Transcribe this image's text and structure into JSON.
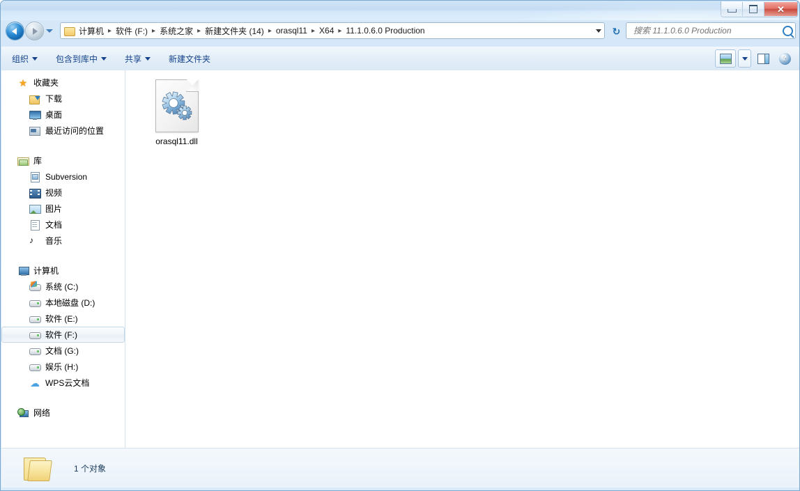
{
  "window": {
    "controls": {
      "minimize_label": "—",
      "maximize_label": "❐",
      "close_label": "✕"
    }
  },
  "navigation": {
    "back_label": "后退",
    "forward_label": "前进",
    "recent_dropdown_label": "最近浏览的位置",
    "refresh_label": "刷新",
    "refresh_glyph": "↻"
  },
  "address": {
    "folder_icon": "folder-icon",
    "breadcrumbs": [
      "计算机",
      "软件 (F:)",
      "系统之家",
      "新建文件夹 (14)",
      "orasql11",
      "X64",
      "11.1.0.6.0 Production"
    ],
    "separator": "▸",
    "dropdown_label": "▾"
  },
  "search": {
    "placeholder": "搜索 11.1.0.6.0 Production",
    "value": "",
    "icon": "search-icon"
  },
  "toolbar": {
    "items": [
      {
        "label": "组织",
        "has_caret": true
      },
      {
        "label": "包含到库中",
        "has_caret": true
      },
      {
        "label": "共享",
        "has_caret": true
      },
      {
        "label": "新建文件夹",
        "has_caret": false
      }
    ],
    "view_button_label": "更改您的视图",
    "view_dropdown_label": "▾",
    "preview_button_label": "显示预览窗格",
    "help_button_label": "?"
  },
  "sidebar": {
    "groups": [
      {
        "header": {
          "label": "收藏夹",
          "icon": "star-icon"
        },
        "items": [
          {
            "label": "下载",
            "icon": "downloads-icon"
          },
          {
            "label": "桌面",
            "icon": "desktop-icon"
          },
          {
            "label": "最近访问的位置",
            "icon": "recent-places-icon"
          }
        ]
      },
      {
        "header": {
          "label": "库",
          "icon": "library-icon"
        },
        "items": [
          {
            "label": "Subversion",
            "icon": "subversion-icon"
          },
          {
            "label": "视频",
            "icon": "video-icon"
          },
          {
            "label": "图片",
            "icon": "pictures-icon"
          },
          {
            "label": "文档",
            "icon": "documents-icon"
          },
          {
            "label": "音乐",
            "icon": "music-icon"
          }
        ]
      },
      {
        "header": {
          "label": "计算机",
          "icon": "computer-icon"
        },
        "items": [
          {
            "label": "系统 (C:)",
            "icon": "system-drive-icon",
            "selected": false
          },
          {
            "label": "本地磁盘 (D:)",
            "icon": "drive-icon",
            "selected": false
          },
          {
            "label": "软件 (E:)",
            "icon": "drive-icon",
            "selected": false
          },
          {
            "label": "软件 (F:)",
            "icon": "drive-icon",
            "selected": true
          },
          {
            "label": "文档 (G:)",
            "icon": "drive-icon",
            "selected": false
          },
          {
            "label": "娱乐 (H:)",
            "icon": "drive-icon",
            "selected": false
          },
          {
            "label": "WPS云文档",
            "icon": "cloud-icon",
            "selected": false
          }
        ]
      },
      {
        "header": {
          "label": "网络",
          "icon": "network-icon"
        },
        "items": []
      }
    ]
  },
  "content": {
    "files": [
      {
        "name": "orasql11.dll",
        "icon": "dll-gear-icon"
      }
    ]
  },
  "status": {
    "icon": "open-folder-icon",
    "text": "1 个对象"
  }
}
